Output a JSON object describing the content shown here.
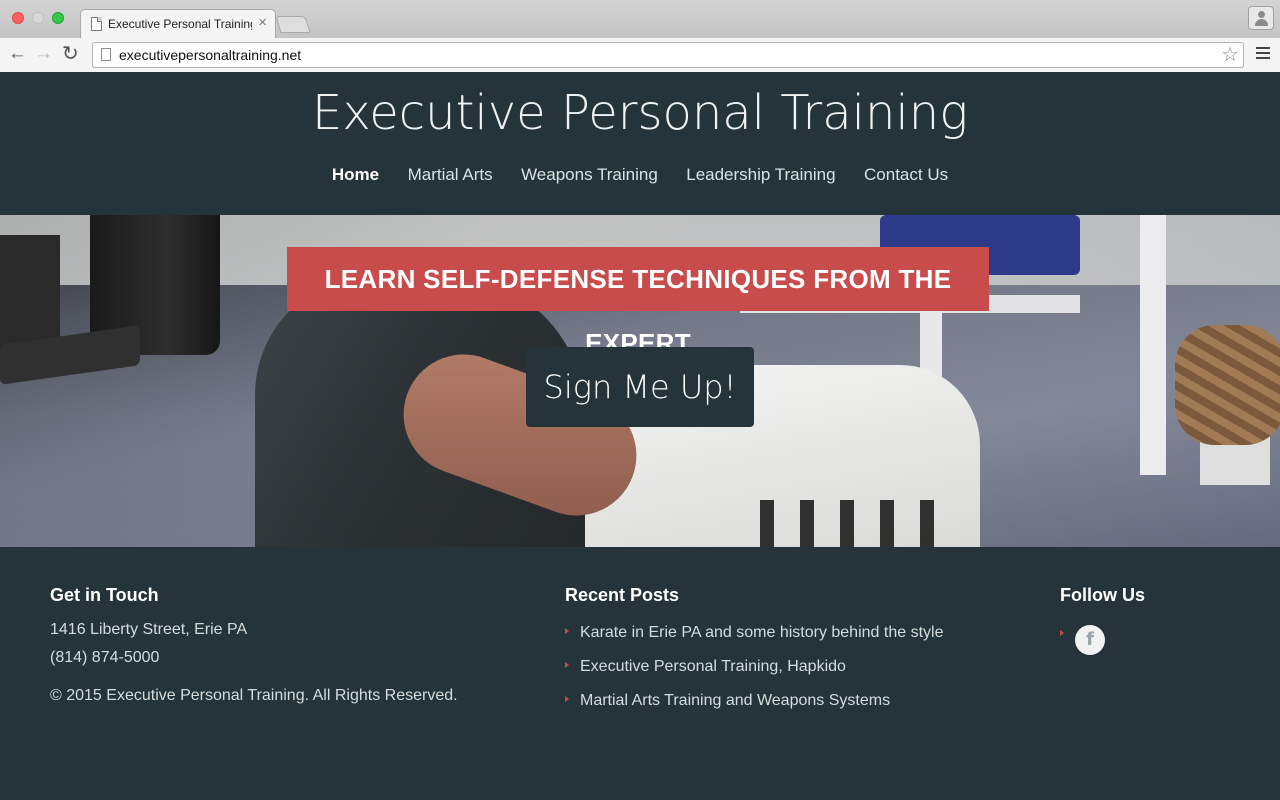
{
  "browser": {
    "tab_title": "Executive Personal Training",
    "tab_close": "×",
    "url": "executivepersonaltraining.net",
    "back": "←",
    "forward": "→",
    "reload": "↻",
    "star": "☆"
  },
  "header": {
    "title": "Executive Personal Training",
    "nav": [
      {
        "label": "Home",
        "active": true
      },
      {
        "label": "Martial Arts"
      },
      {
        "label": "Weapons Training"
      },
      {
        "label": "Leadership Training"
      },
      {
        "label": "Contact Us"
      }
    ]
  },
  "hero": {
    "banner": "LEARN SELF-DEFENSE TECHNIQUES FROM THE EXPERT",
    "cta": "Sign Me Up!"
  },
  "footer": {
    "contact": {
      "title": "Get in Touch",
      "address": "1416 Liberty Street, Erie PA",
      "phone": "(814) 874-5000",
      "copyright": "© 2015 Executive Personal Training. All Rights Reserved."
    },
    "posts": {
      "title": "Recent Posts",
      "items": [
        "Karate in Erie PA and some history behind the style",
        "Executive Personal Training, Hapkido",
        "Martial Arts Training and Weapons Systems"
      ]
    },
    "follow": {
      "title": "Follow Us",
      "facebook_glyph": "f",
      "icon": "facebook-icon"
    }
  },
  "colors": {
    "dark": "#25343a",
    "accent": "#c84c4c"
  }
}
